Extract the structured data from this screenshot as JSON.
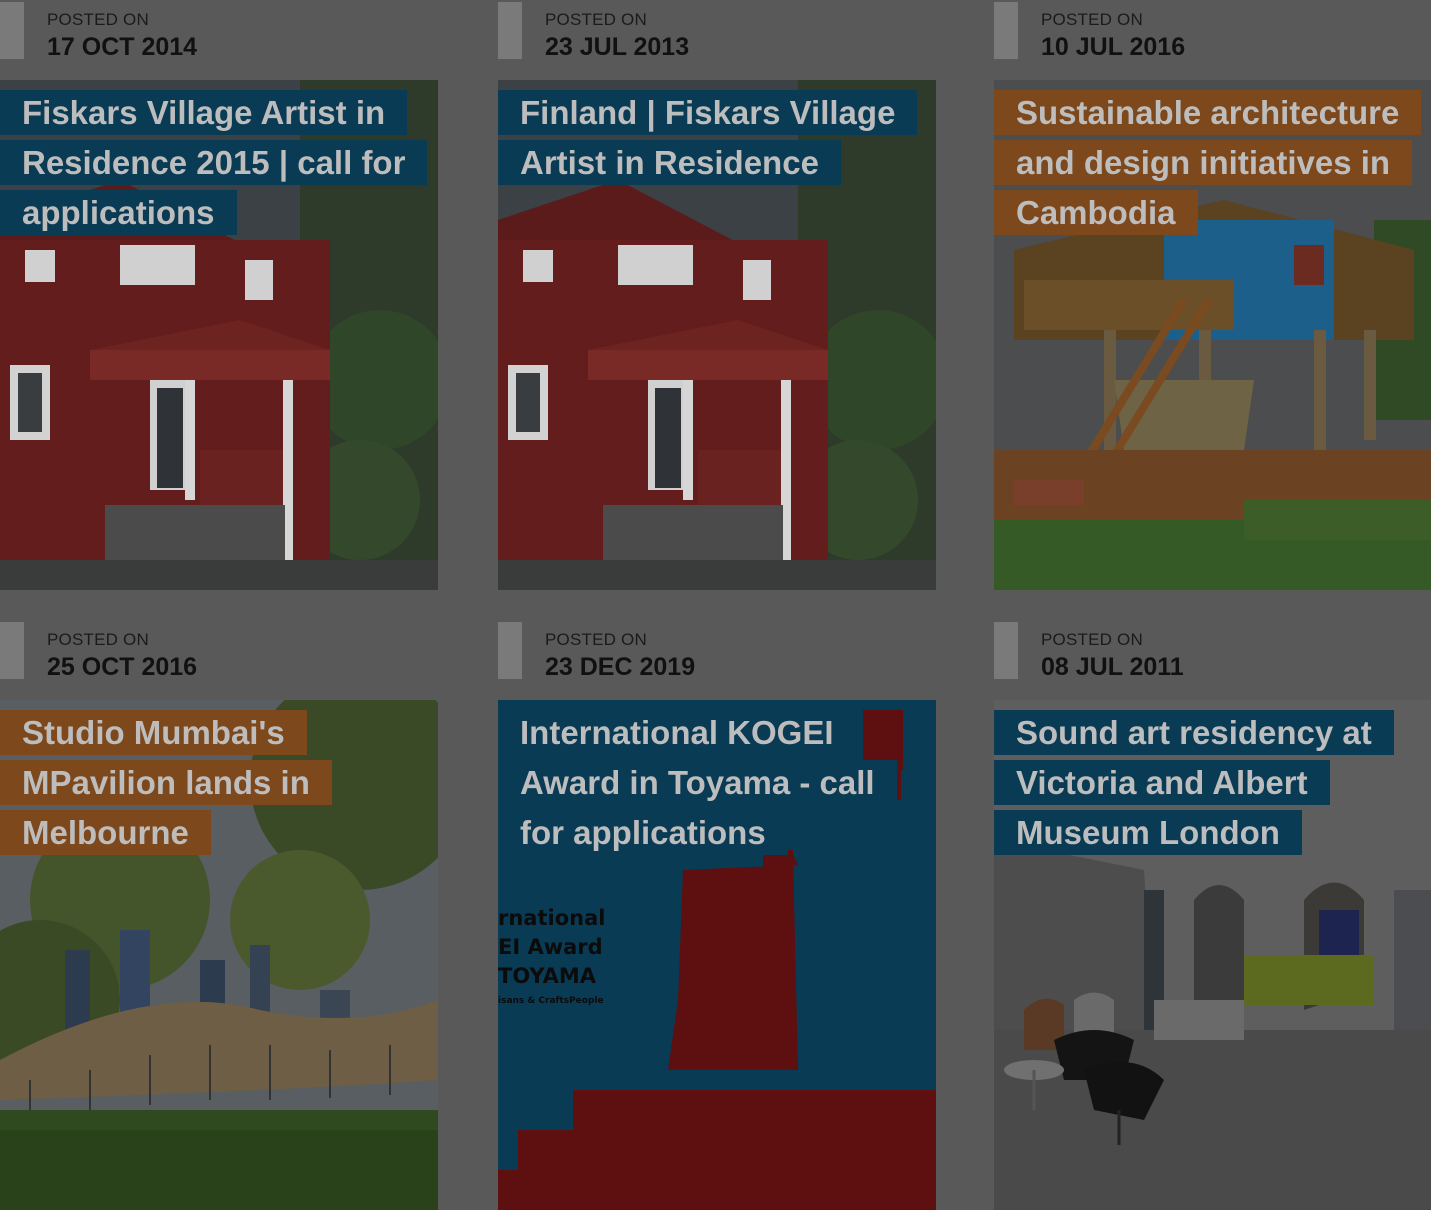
{
  "posts": [
    {
      "posted_label": "POSTED ON",
      "date": "17 OCT 2014",
      "title": "Fiskars Village Artist in Residence 2015 | call for applications",
      "title_color": "#0a3b55",
      "image_icon": "red-wooden-house-image"
    },
    {
      "posted_label": "POSTED ON",
      "date": "23 JUL 2013",
      "title": "Finland | Fiskars Village Artist in Residence",
      "title_color": "#0a3b55",
      "image_icon": "red-wooden-house-image"
    },
    {
      "posted_label": "POSTED ON",
      "date": "10 JUL 2016",
      "title": "Sustainable architecture and design initiatives in Cambodia",
      "title_color": "#7d481c",
      "image_icon": "stilt-house-image"
    },
    {
      "posted_label": "POSTED ON",
      "date": "25 OCT 2016",
      "title": "Studio Mumbai's MPavilion lands in Melbourne",
      "title_color": "#7d481c",
      "image_icon": "pavilion-park-image"
    },
    {
      "posted_label": "POSTED ON",
      "date": "23 DEC 2019",
      "title": "International KOGEI Award in Toyama - call for applications",
      "title_color": "#0a3b55",
      "image_icon": "kogei-poster-image",
      "poster_text": [
        "rnational",
        "EI Award",
        "TOYAMA",
        "isans & CraftsPeople"
      ]
    },
    {
      "posted_label": "POSTED ON",
      "date": "08 JUL 2011",
      "title": "Sound art residency at Victoria and Albert Museum London",
      "title_color": "#0a3b55",
      "image_icon": "museum-lobby-image"
    }
  ]
}
